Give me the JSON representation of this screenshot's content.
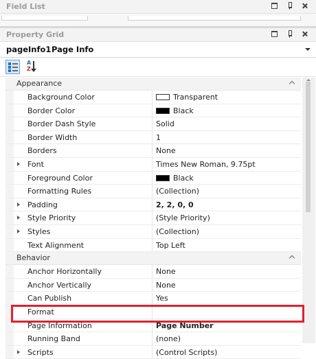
{
  "field_list": {
    "title": "Field List"
  },
  "property_grid": {
    "title": "Property Grid"
  },
  "selector": {
    "object_name": "pageInfo1",
    "object_type": "Page Info"
  },
  "toolbar": {
    "categorized_icon": "categorized-icon",
    "alphabetical_icon": "alphabetical-sort-icon"
  },
  "categories": {
    "appearance": "Appearance",
    "behavior": "Behavior"
  },
  "appearance_rows": [
    {
      "name": "Background Color",
      "value": "Transparent"
    },
    {
      "name": "Border Color",
      "value": "Black"
    },
    {
      "name": "Border Dash Style",
      "value": "Solid"
    },
    {
      "name": "Border Width",
      "value": "1"
    },
    {
      "name": "Borders",
      "value": "None"
    },
    {
      "name": "Font",
      "value": "Times New Roman, 9.75pt"
    },
    {
      "name": "Foreground Color",
      "value": "Black"
    },
    {
      "name": "Formatting Rules",
      "value": "(Collection)"
    },
    {
      "name": "Padding",
      "value": "2, 2, 0, 0"
    },
    {
      "name": "Style Priority",
      "value": "(Style Priority)"
    },
    {
      "name": "Styles",
      "value": "(Collection)"
    },
    {
      "name": "Text Alignment",
      "value": "Top Left"
    }
  ],
  "behavior_rows": [
    {
      "name": "Anchor Horizontally",
      "value": "None"
    },
    {
      "name": "Anchor Vertically",
      "value": "None"
    },
    {
      "name": "Can Publish",
      "value": "Yes"
    },
    {
      "name": "Format",
      "value": ""
    },
    {
      "name": "Page Information",
      "value": "Page Number"
    },
    {
      "name": "Running Band",
      "value": "(none)"
    },
    {
      "name": "Scripts",
      "value": "(Control Scripts)"
    }
  ],
  "colors": {
    "highlight": "#e2202d",
    "swatch_transparent": "#ffffff",
    "swatch_black": "#000000"
  }
}
